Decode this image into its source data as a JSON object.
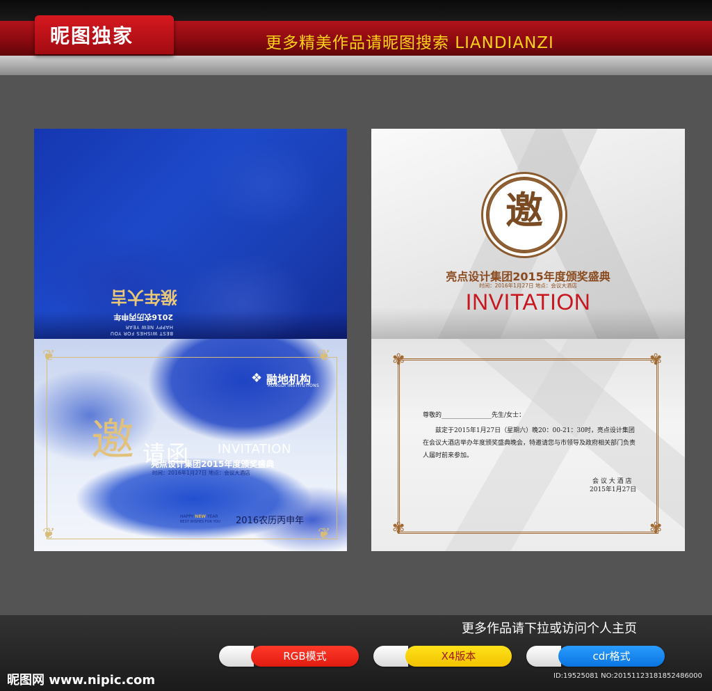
{
  "banner": {
    "brand": "昵图独家",
    "slogan": "更多精美作品请昵图搜索    LIANDIANZI"
  },
  "cover_top": {
    "best_wishes": "BEST WISHES FOR YOU",
    "happy_new_year": "HAPPY NEW YEAR",
    "year_text": "2016农历丙申年",
    "calligraphy": "猴年大吉"
  },
  "cover_bottom": {
    "logo_name": "融地机构",
    "logo_sub": "RONGDI INSTITUTIONS",
    "yao": "邀",
    "qinghan": "请函",
    "invitation": "INVITATION",
    "subtitle": "亮点设计集团2015年度颁奖盛典",
    "time_line": "时间：2016年1月27日     地点：会议大酒店",
    "happy_prefix": "HAPPY ",
    "happy_new": "NEW",
    "happy_suffix": " YEAR",
    "best_wishes": "BEST WISHES FOR YOU",
    "year_text": "2016农历丙申年"
  },
  "inside_top": {
    "seal_char": "邀",
    "title": "亮点设计集团2015年度颁奖盛典",
    "time_line": "时间：2016年1月27日   地点：会议大酒店",
    "invitation": "INVITATION"
  },
  "letter": {
    "salutation": "尊敬的________________先生/女士：",
    "line1": "兹定于2015年1月27日（星期六）晚20：00-21：30时，亮点设计集团",
    "line2": "在会议大酒店举办年度颁奖盛典晚会，特邀请您与市领导及政府相关部门负责",
    "line3": "人届时前来参加。",
    "sign_place": "会 议 大 酒 店",
    "sign_date": "2015年1月27日"
  },
  "footer": {
    "more_text": "更多作品请下拉或访问个人主页",
    "pills": [
      {
        "label": "RGB模式"
      },
      {
        "label": "X4版本"
      },
      {
        "label": "cdr格式"
      }
    ],
    "site": "昵图网 www.nipic.com",
    "id_text": "ID:19525081 NO:20151123181852486000"
  }
}
